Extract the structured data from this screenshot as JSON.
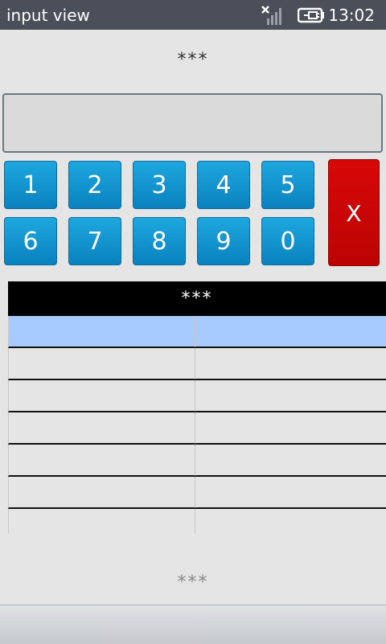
{
  "statusbar": {
    "app_title": "input view",
    "time": "13:02",
    "icons": [
      "no-signal-icon",
      "battery-charging-icon"
    ]
  },
  "header": {
    "masked_text": "***"
  },
  "input": {
    "value": ""
  },
  "keypad": {
    "keys": [
      "1",
      "2",
      "3",
      "4",
      "5",
      "6",
      "7",
      "8",
      "9",
      "0"
    ],
    "clear_label": "X",
    "colors": {
      "key": "#0f94cf",
      "clear": "#cc0505"
    }
  },
  "table": {
    "header": "***",
    "rows": [
      [
        "",
        ""
      ],
      [
        "",
        ""
      ],
      [
        "",
        ""
      ],
      [
        "",
        ""
      ],
      [
        "",
        ""
      ],
      [
        "",
        ""
      ],
      [
        "",
        ""
      ]
    ],
    "selected_row_color": "#a7cbff"
  },
  "footer": {
    "masked_text": "***"
  }
}
